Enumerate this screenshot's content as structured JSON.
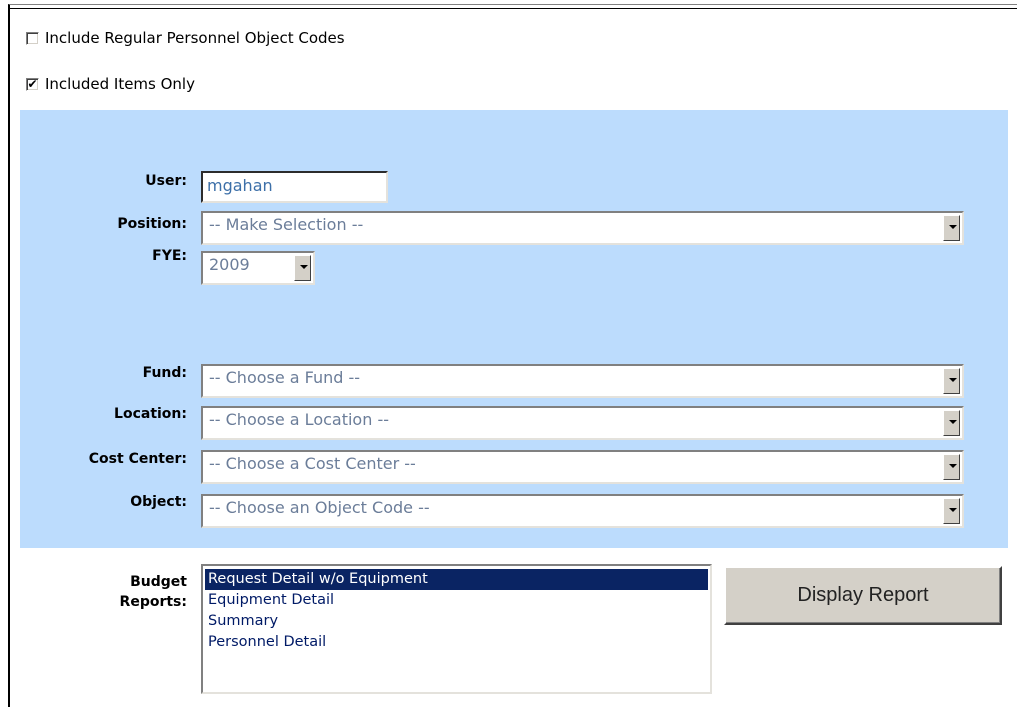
{
  "options": {
    "include_personnel": {
      "label": "Include Regular Personnel Object Codes",
      "checked": false
    },
    "included_only": {
      "label": "Included Items Only",
      "checked": true
    }
  },
  "form": {
    "user": {
      "label": "User:",
      "value": "mgahan"
    },
    "position": {
      "label": "Position:",
      "value": "-- Make Selection --"
    },
    "fye": {
      "label": "FYE:",
      "value": "2009"
    },
    "fund": {
      "label": "Fund:",
      "value": "-- Choose a Fund --"
    },
    "location": {
      "label": "Location:",
      "value": "-- Choose a Location --"
    },
    "cost_center": {
      "label": "Cost Center:",
      "value": "-- Choose a Cost Center --"
    },
    "object": {
      "label": "Object:",
      "value": "-- Choose an Object Code --"
    }
  },
  "reports": {
    "label_line1": "Budget",
    "label_line2": "Reports:",
    "items": [
      "Request Detail w/o Equipment",
      "Equipment Detail",
      "Summary",
      "Personnel Detail"
    ],
    "selected_index": 0,
    "button_label": "Display Report"
  },
  "colors": {
    "panel": "#bcdcfd",
    "selection": "#0a2463"
  }
}
